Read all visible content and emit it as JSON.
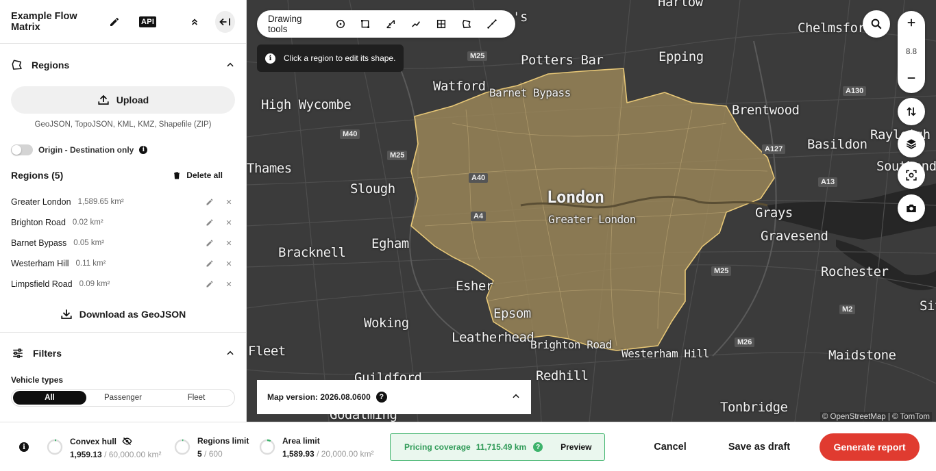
{
  "sidebar": {
    "title": "Example Flow Matrix",
    "api_label": "API",
    "regions_section": {
      "label": "Regions",
      "upload_label": "Upload",
      "formats": "GeoJSON, TopoJSON, KML, KMZ, Shapefile (ZIP)",
      "od_toggle_label": "Origin - Destination only",
      "od_toggle_on": false,
      "count_label": "Regions (5)",
      "delete_all_label": "Delete all",
      "items": [
        {
          "name": "Greater London",
          "area": "1,589.65 km²"
        },
        {
          "name": "Brighton Road",
          "area": "0.02 km²"
        },
        {
          "name": "Barnet Bypass",
          "area": "0.05 km²"
        },
        {
          "name": "Westerham Hill",
          "area": "0.11 km²"
        },
        {
          "name": "Limpsfield Road",
          "area": "0.09 km²"
        }
      ],
      "download_label": "Download as GeoJSON"
    },
    "filters_section": {
      "label": "Filters",
      "vehicle_types_label": "Vehicle types",
      "options": [
        "All",
        "Passenger",
        "Fleet"
      ],
      "selected": "All"
    }
  },
  "map": {
    "drawing_tools_label": "Drawing tools",
    "tools": [
      "circle-tool-icon",
      "rectangle-tool-icon",
      "line-tool-icon",
      "route-tool-icon",
      "grid-tool-icon",
      "polygon-tool-icon",
      "freehand-tool-icon"
    ],
    "hint": "Click a region to edit its shape.",
    "zoom_level": "8.8",
    "map_version_label": "Map version: 2026.08.0600",
    "attribution": "© OpenStreetMap | © TomTom",
    "places": {
      "harlow": "Harlow",
      "chelmsford": "Chelmsford",
      "potters_bar": "Potters Bar",
      "epping": "Epping",
      "watford": "Watford",
      "barnet_bypass": "Barnet Bypass",
      "high_wycombe": "High Wycombe",
      "brentwood": "Brentwood",
      "rayleigh": "Rayleigh",
      "basildon": "Basildon",
      "thames": "Thames",
      "southend": "Southend",
      "slough": "Slough",
      "london": "London",
      "greater_london": "Greater London",
      "grays": "Grays",
      "egham": "Egham",
      "gravesend": "Gravesend",
      "bracknell": "Bracknell",
      "rochester": "Rochester",
      "esher": "Esher",
      "epsom": "Epsom",
      "sitting": "Sittingbourne",
      "woking": "Woking",
      "leatherhead": "Leatherhead",
      "brighton_road": "Brighton Road",
      "westerham_hill": "Westerham Hill",
      "maidstone": "Maidstone",
      "fleet": "Fleet",
      "guildford": "Guildford",
      "redhill": "Redhill",
      "tonbridge": "Tonbridge",
      "godalming": "Godalming",
      "st_albans_fragment": "'s"
    },
    "roads": {
      "m25a": "M25",
      "m40": "M40",
      "m25b": "M25",
      "a40": "A40",
      "a4": "A4",
      "a130": "A130",
      "a127": "A127",
      "a13": "A13",
      "m25c": "M25",
      "m2": "M2",
      "m26": "M26"
    },
    "colors": {
      "region_fill": "#a08a5a",
      "region_stroke": "#e8c877",
      "map_bg": "#3a3a3a"
    }
  },
  "bottom": {
    "convex_hull": {
      "label": "Convex hull",
      "value": "1,959.13",
      "limit": "/ 60,000.00 km²",
      "fraction": 0.033
    },
    "regions_limit": {
      "label": "Regions limit",
      "value": "5",
      "limit": "/ 600",
      "fraction": 0.008
    },
    "area_limit": {
      "label": "Area limit",
      "value": "1,589.93",
      "limit": "/ 20,000.00 km²",
      "fraction": 0.08
    },
    "pricing_label": "Pricing coverage",
    "pricing_value": "11,715.49 km",
    "preview_label": "Preview",
    "cancel_label": "Cancel",
    "save_draft_label": "Save as draft",
    "generate_label": "Generate report"
  }
}
